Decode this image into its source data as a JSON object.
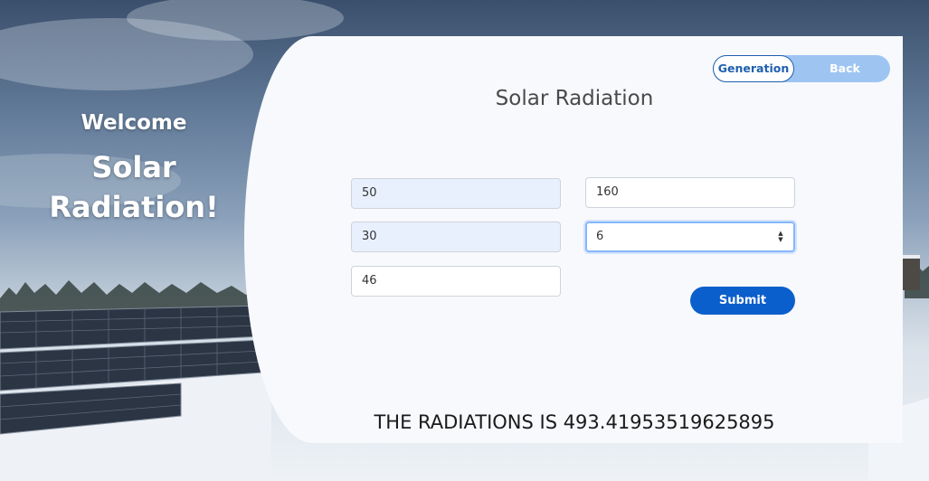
{
  "hero": {
    "welcome": "Welcome",
    "title_line1": "Solar",
    "title_line2": "Radiation!"
  },
  "toggle": {
    "active_label": "Generation",
    "inactive_label": "Back"
  },
  "form": {
    "title": "Solar Radiation",
    "fields": [
      {
        "value": "50"
      },
      {
        "value": "160"
      },
      {
        "value": "30"
      },
      {
        "value": "6"
      },
      {
        "value": "46"
      }
    ],
    "submit_label": "Submit"
  },
  "result": {
    "text": "THE RADIATIONS IS 493.41953519625895"
  },
  "colors": {
    "primary": "#0b5fcc",
    "toggle_bg": "#9ec5f2",
    "card_bg": "#f7f9fc",
    "autofill_bg": "#e8f0fe"
  },
  "icons": {
    "spinner": "spin-button-icon"
  }
}
